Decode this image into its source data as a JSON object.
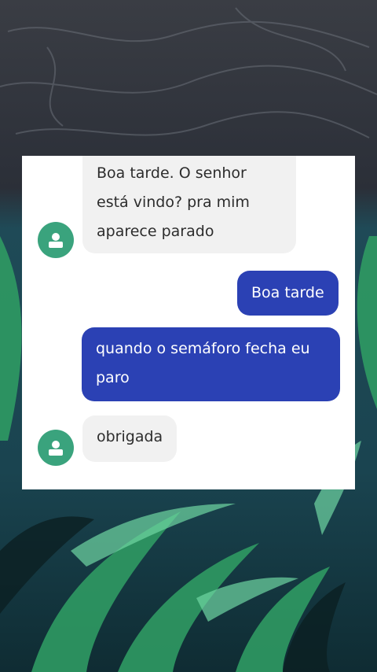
{
  "messages": [
    {
      "direction": "incoming",
      "text": "Boa tarde. O senhor está vindo? pra mim aparece parado"
    },
    {
      "direction": "outgoing",
      "text": "Boa tarde"
    },
    {
      "direction": "outgoing",
      "text": "quando o semáforo fecha eu paro"
    },
    {
      "direction": "incoming",
      "text": "obrigada"
    }
  ],
  "contact": {
    "avatar_icon": "person-icon",
    "avatar_color": "#3aa37d"
  },
  "colors": {
    "incoming_bubble": "#f1f1f1",
    "outgoing_bubble": "#2b41b4",
    "card_background": "#ffffff"
  },
  "background": {
    "description_icon": "seaweed-underwater-wallpaper"
  }
}
